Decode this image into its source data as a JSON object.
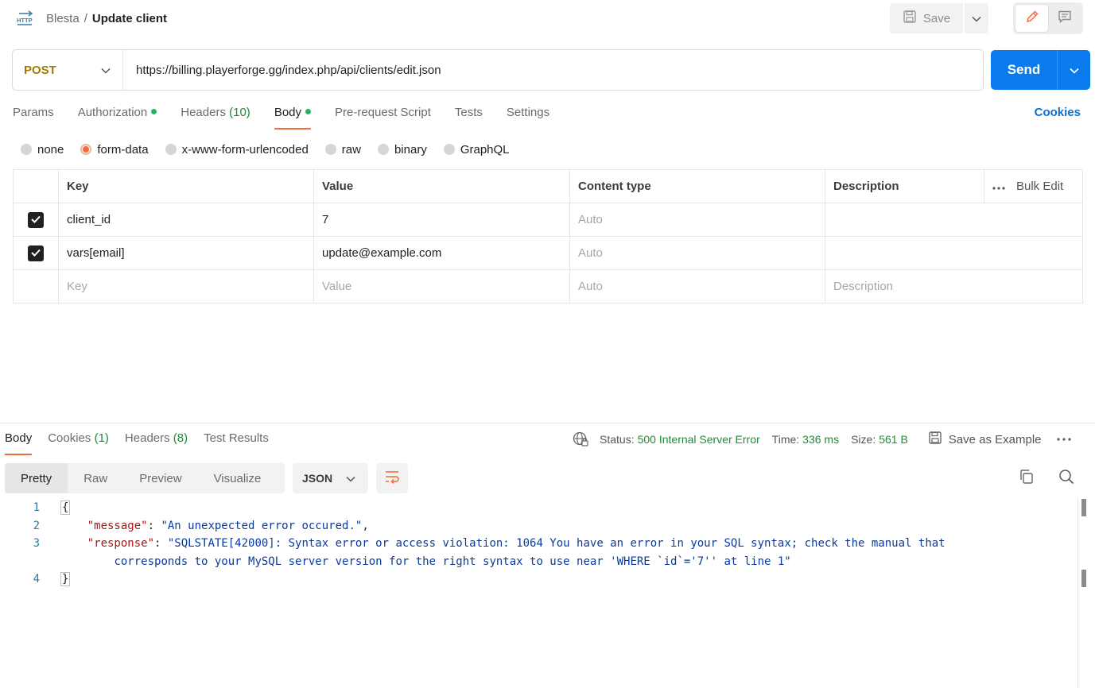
{
  "header": {
    "breadcrumb_parent": "Blesta",
    "breadcrumb_sep": "/",
    "breadcrumb_current": "Update client",
    "save_label": "Save"
  },
  "request": {
    "method": "POST",
    "url": "https://billing.playerforge.gg/index.php/api/clients/edit.json",
    "send_label": "Send"
  },
  "tabs": {
    "params": "Params",
    "authorization": "Authorization",
    "headers": "Headers",
    "headers_count": "(10)",
    "body": "Body",
    "prerequest": "Pre-request Script",
    "tests": "Tests",
    "settings": "Settings",
    "cookies": "Cookies"
  },
  "body_types": {
    "none": "none",
    "form_data": "form-data",
    "urlencoded": "x-www-form-urlencoded",
    "raw": "raw",
    "binary": "binary",
    "graphql": "GraphQL",
    "selected": "form-data"
  },
  "table": {
    "headers": {
      "key": "Key",
      "value": "Value",
      "content_type": "Content type",
      "description": "Description",
      "bulk_edit": "Bulk Edit"
    },
    "rows": [
      {
        "checked": true,
        "key": "client_id",
        "value": "7",
        "content_type": "Auto",
        "description": ""
      },
      {
        "checked": true,
        "key": "vars[email]",
        "value": "update@example.com",
        "content_type": "Auto",
        "description": ""
      }
    ],
    "placeholder": {
      "key": "Key",
      "value": "Value",
      "content_type": "Auto",
      "description": "Description"
    }
  },
  "response": {
    "tabs": {
      "body": "Body",
      "cookies": "Cookies",
      "cookies_count": "(1)",
      "headers": "Headers",
      "headers_count": "(8)",
      "tests": "Test Results"
    },
    "status_label": "Status:",
    "status_value": "500 Internal Server Error",
    "time_label": "Time:",
    "time_value": "336 ms",
    "size_label": "Size:",
    "size_value": "561 B",
    "save_example": "Save as Example",
    "views": {
      "pretty": "Pretty",
      "raw": "Raw",
      "preview": "Preview",
      "visualize": "Visualize"
    },
    "format": "JSON",
    "code": {
      "l1": "{",
      "l2_key": "\"message\"",
      "l2_val": "\"An unexpected error occured.\"",
      "l3_key": "\"response\"",
      "l3_val_a": "\"SQLSTATE[42000]: Syntax error or access violation: 1064 You have an error in your SQL syntax; check the manual that",
      "l3_val_b": "corresponds to your MySQL server version for the right syntax to use near 'WHERE `id`='7'' at line 1\"",
      "l4": "}"
    }
  }
}
